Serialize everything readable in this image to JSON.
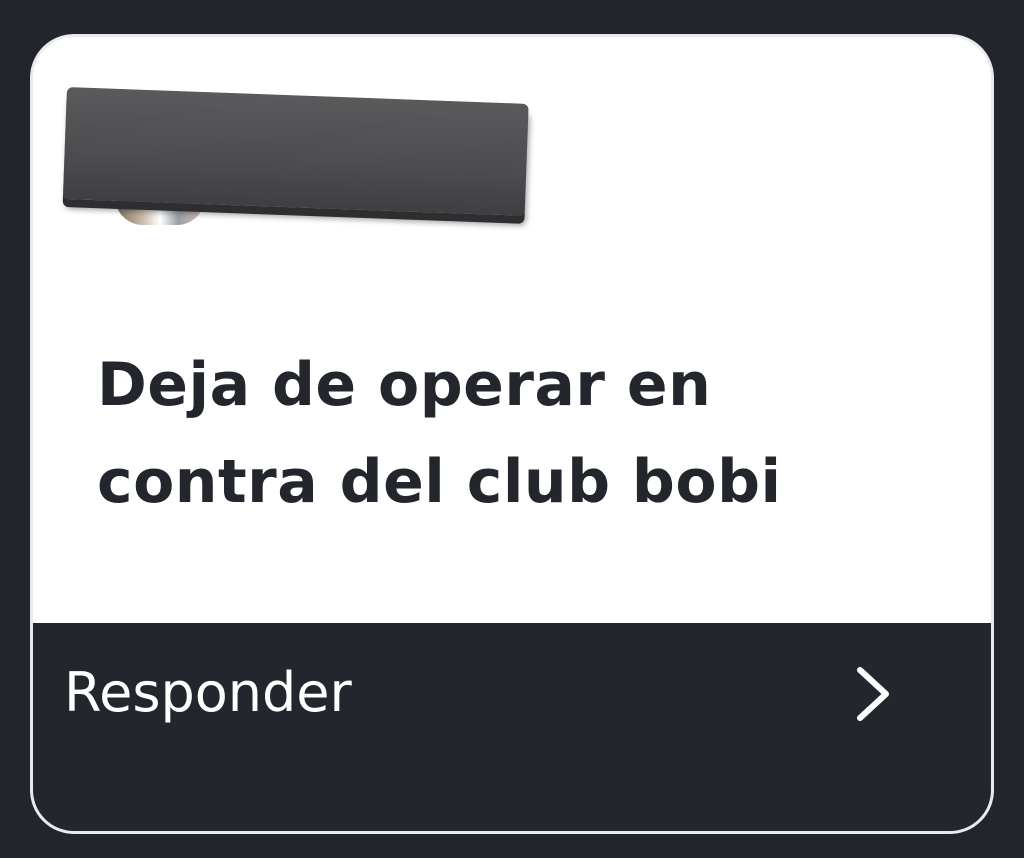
{
  "post": {
    "title": "Deja de operar en contra del club bobi",
    "author_redacted": true
  },
  "actions": {
    "reply_label": "Responder",
    "reply_icon": "chevron-right-icon"
  },
  "colors": {
    "background": "#22252c",
    "card": "#ffffff",
    "card_border": "#e9eaee",
    "footer": "#23262d",
    "title_text": "#23262d",
    "footer_text": "#ffffff",
    "redaction": "#4d4d50"
  }
}
